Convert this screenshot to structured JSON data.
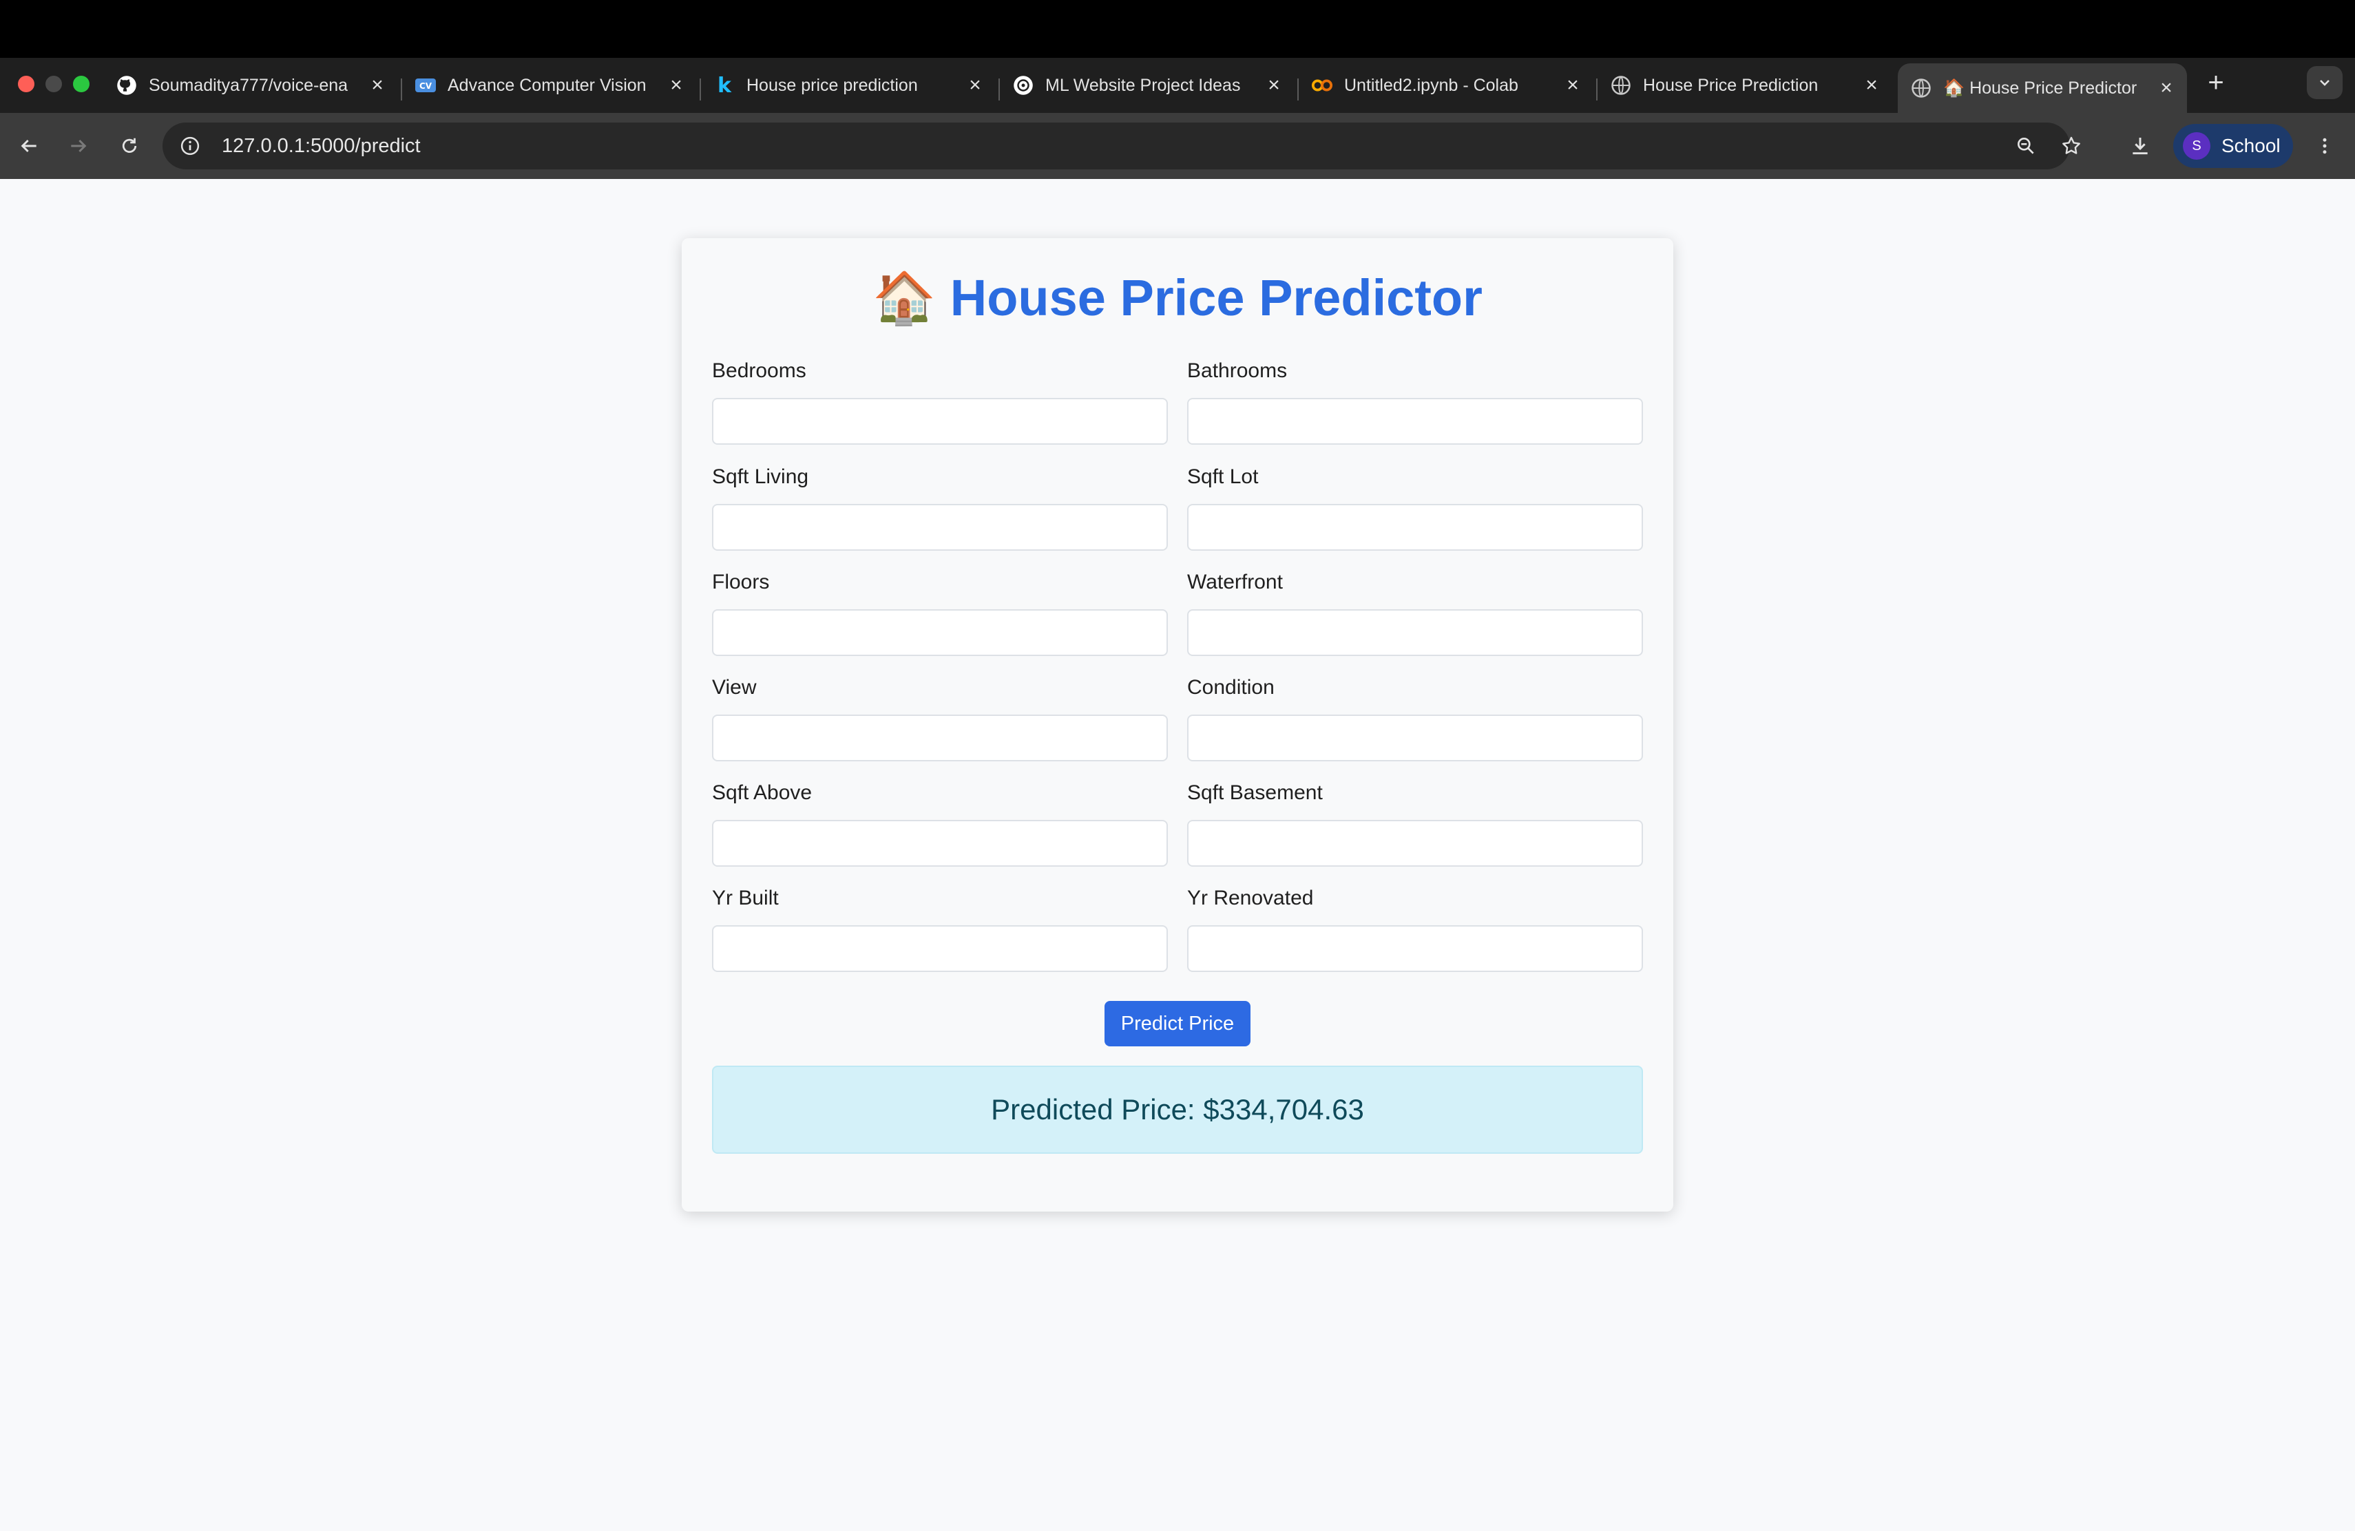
{
  "browser": {
    "tabs": [
      {
        "title": "Soumaditya777/voice-ena",
        "icon": "github-icon"
      },
      {
        "title": "Advance Computer Vision",
        "icon": "cv-icon"
      },
      {
        "title": "House price prediction",
        "icon": "kaggle-icon"
      },
      {
        "title": "ML Website Project Ideas",
        "icon": "openai-icon"
      },
      {
        "title": "Untitled2.ipynb - Colab",
        "icon": "colab-icon"
      },
      {
        "title": "House Price Prediction",
        "icon": "globe-icon"
      },
      {
        "title": "🏠 House Price Predictor",
        "icon": "globe-icon",
        "active": true
      }
    ],
    "url": "127.0.0.1:5000/predict",
    "profile": {
      "initial": "S",
      "name": "School"
    }
  },
  "form": {
    "title_emoji": "🏠",
    "title": "House Price Predictor",
    "fields": [
      {
        "label": "Bedrooms",
        "value": ""
      },
      {
        "label": "Bathrooms",
        "value": ""
      },
      {
        "label": "Sqft Living",
        "value": ""
      },
      {
        "label": "Sqft Lot",
        "value": ""
      },
      {
        "label": "Floors",
        "value": ""
      },
      {
        "label": "Waterfront",
        "value": ""
      },
      {
        "label": "View",
        "value": ""
      },
      {
        "label": "Condition",
        "value": ""
      },
      {
        "label": "Sqft Above",
        "value": ""
      },
      {
        "label": "Sqft Basement",
        "value": ""
      },
      {
        "label": "Yr Built",
        "value": ""
      },
      {
        "label": "Yr Renovated",
        "value": ""
      }
    ],
    "submit_label": "Predict Price",
    "result": "Predicted Price: $334,704.63"
  },
  "colors": {
    "accent": "#2d6ae3",
    "title": "#2b6ce0",
    "result_bg": "#d4f1f9",
    "result_text": "#0f4a5a"
  }
}
